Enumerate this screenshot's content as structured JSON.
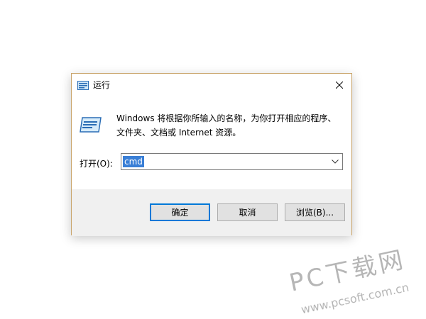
{
  "dialog": {
    "title": "运行",
    "description": "Windows 将根据你所输入的名称，为你打开相应的程序、文件夹、文档或 Internet 资源。",
    "open_label": "打开(O):",
    "command_value": "cmd",
    "buttons": {
      "ok": "确定",
      "cancel": "取消",
      "browse": "浏览(B)..."
    }
  },
  "watermark": {
    "title": "PC下载网",
    "url": "www.pcsoft.com.cn"
  },
  "colors": {
    "accent": "#0078d7",
    "selection": "#3a7fd6",
    "window_border": "#c9a46a"
  },
  "icons": [
    "run-app-icon",
    "run-large-icon",
    "close-icon",
    "chevron-down-icon"
  ]
}
